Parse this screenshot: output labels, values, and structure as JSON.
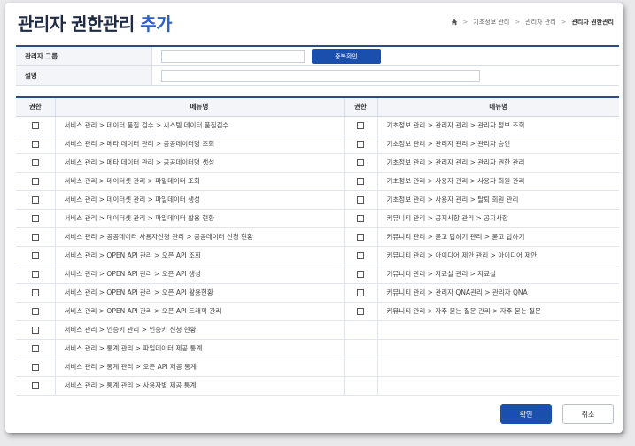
{
  "header": {
    "title_main": "관리자 권한관리",
    "title_accent": "추가",
    "breadcrumb": [
      "기초정보 관리",
      "관리자 관리",
      "관리자 권한관리"
    ]
  },
  "form": {
    "group_label": "관리자 그룹",
    "group_value": "",
    "dup_check_label": "중복확인",
    "desc_label": "설명",
    "desc_value": ""
  },
  "grid": {
    "col_check": "권한",
    "col_menu": "메뉴명",
    "left": [
      "서비스 관리 > 데이터 품질 검수 > 시스템 데이터 품질검수",
      "서비스 관리 > 메타 데이터 관리 > 공공데이터명 조회",
      "서비스 관리 > 메타 데이터 관리 > 공공데이터명 생성",
      "서비스 관리 > 데이터셋 관리 > 파일데이터 조회",
      "서비스 관리 > 데이터셋 관리 > 파일데이터 생성",
      "서비스 관리 > 데이터셋 관리 > 파일데이터 활용 현황",
      "서비스 관리 > 공공데이터 사용자신청 관리 > 공공데이터 신청 현황",
      "서비스 관리 > OPEN API 관리 > 오픈 API 조회",
      "서비스 관리 > OPEN API 관리 > 오픈 API 생성",
      "서비스 관리 > OPEN API 관리 > 오픈 API 활용현황",
      "서비스 관리 > OPEN API 관리 > 오픈 API 트래픽 관리",
      "서비스 관리 > 인증키 관리 > 인증키 신청 현황",
      "서비스 관리 > 통계 관리 > 파일데이터 제공 통계",
      "서비스 관리 > 통계 관리 > 오픈 API 제공 통계",
      "서비스 관리 > 통계 관리 > 사용자별 제공 통계"
    ],
    "right": [
      "기초정보 관리 > 관리자 관리 > 관리자 정보 조회",
      "기초정보 관리 > 관리자 관리 > 관리자 승인",
      "기초정보 관리 > 관리자 관리 > 관리자 권한 관리",
      "기초정보 관리 > 사용자 관리 > 사용자 회원 관리",
      "기초정보 관리 > 사용자 관리 > 탈퇴 회원 관리",
      "커뮤니티 관리 > 공지사항 관리 > 공지사항",
      "커뮤니티 관리 > 묻고 답하기 관리 > 묻고 답하기",
      "커뮤니티 관리 > 아이디어 제안 관리 > 아이디어 제안",
      "커뮤니티 관리 > 자료실 관리 > 자료실",
      "커뮤니티 관리 > 관리자 QNA관리 > 관리자 QNA",
      "커뮤니티 관리 > 자주 묻는 질문 관리 > 자주 묻는 질문"
    ]
  },
  "footer": {
    "ok_label": "확인",
    "cancel_label": "취소"
  }
}
